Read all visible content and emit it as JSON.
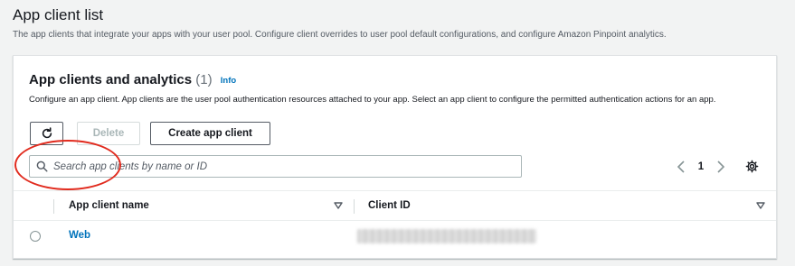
{
  "page": {
    "title": "App client list",
    "description": "The app clients that integrate your apps with your user pool. Configure client overrides to user pool default configurations, and configure Amazon Pinpoint analytics."
  },
  "container": {
    "title": "App clients and analytics",
    "count": "(1)",
    "info_link": "Info",
    "description": "Configure an app client. App clients are the user pool authentication resources attached to your app. Select an app client to configure the permitted authentication actions for an app."
  },
  "actions": {
    "refresh_icon": "refresh-icon",
    "delete_label": "Delete",
    "create_label": "Create app client"
  },
  "search": {
    "placeholder": "Search app clients by name or ID",
    "value": ""
  },
  "pagination": {
    "current_page": "1"
  },
  "table": {
    "columns": [
      "App client name",
      "Client ID"
    ],
    "rows": [
      {
        "name": "Web",
        "client_id": "(redacted)"
      }
    ]
  },
  "colors": {
    "link": "#0073bb",
    "annotation": "#e12b1e",
    "border": "#aab7b8"
  }
}
